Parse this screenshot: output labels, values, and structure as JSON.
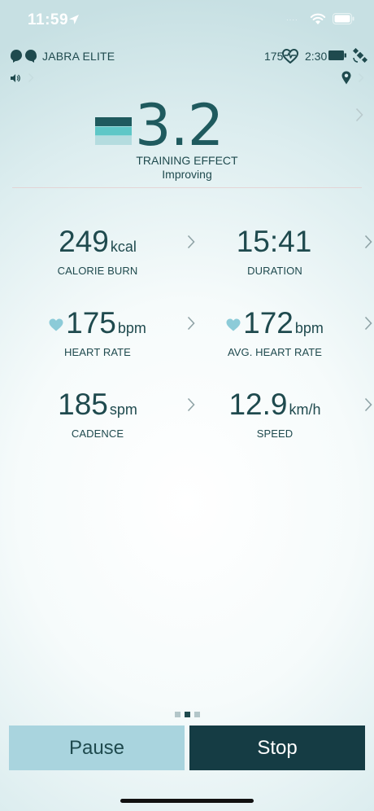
{
  "status_bar": {
    "time": "11:59",
    "signal_text": "····"
  },
  "device_bar": {
    "device_name": "JABRA ELITE",
    "heart_rate": "175",
    "elapsed": "2:30",
    "icons": [
      "earbuds-icon",
      "heart-ecg-icon",
      "battery-icon",
      "satellite-icon",
      "sound-icon",
      "location-icon"
    ]
  },
  "training_effect": {
    "value": "3.2",
    "label": "TRAINING EFFECT",
    "status": "Improving"
  },
  "metrics": [
    {
      "value": "249",
      "unit": "kcal",
      "label": "CALORIE BURN",
      "heart": false
    },
    {
      "value": "15:41",
      "unit": "",
      "label": "DURATION",
      "heart": false
    },
    {
      "value": "175",
      "unit": "bpm",
      "label": "HEART RATE",
      "heart": true
    },
    {
      "value": "172",
      "unit": "bpm",
      "label": "AVG. HEART RATE",
      "heart": true
    },
    {
      "value": "185",
      "unit": "spm",
      "label": "CADENCE",
      "heart": false
    },
    {
      "value": "12.9",
      "unit": "km/h",
      "label": "SPEED",
      "heart": false
    }
  ],
  "pager": {
    "count": 3,
    "active_index": 1
  },
  "buttons": {
    "pause": "Pause",
    "stop": "Stop"
  },
  "colors": {
    "text": "#1f4a4e",
    "accent_light": "#a9d4de",
    "accent_dark": "#153c44",
    "heart": "#8ccbd8"
  }
}
